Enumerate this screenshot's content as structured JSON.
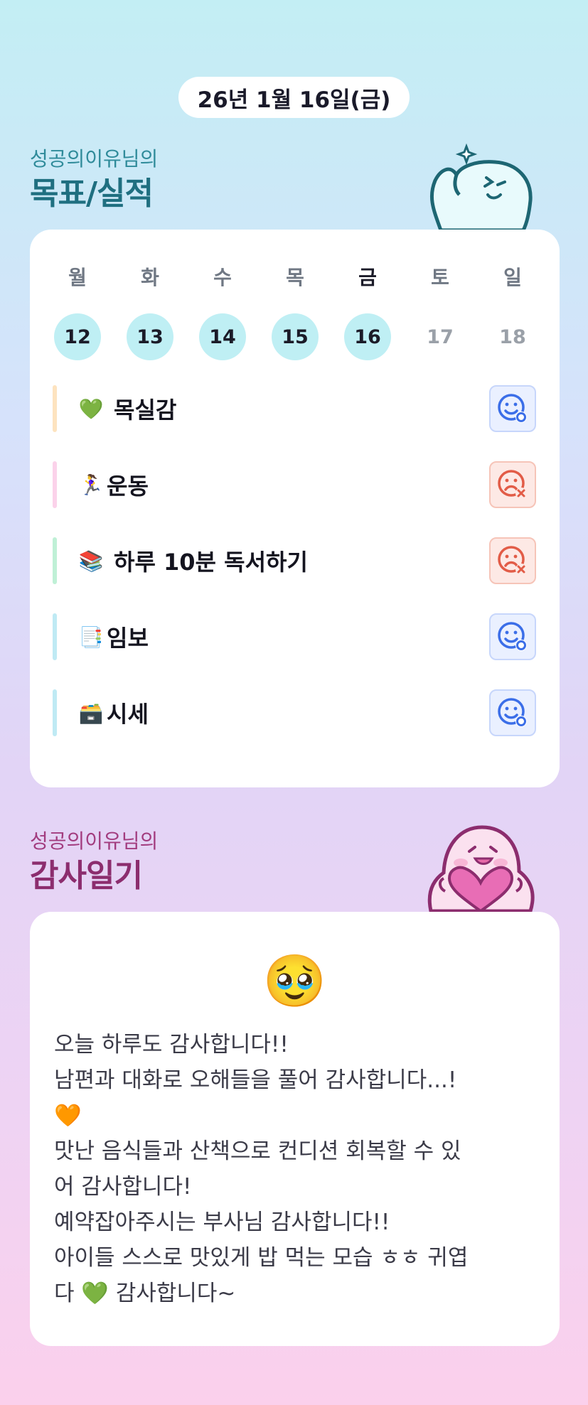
{
  "header": {
    "date": "26년 1월 16일(금)"
  },
  "goals_section": {
    "subtitle": "성공의이유님의",
    "title": "목표/실적",
    "week": [
      {
        "label": "월",
        "date": "12",
        "state": "done"
      },
      {
        "label": "화",
        "date": "13",
        "state": "done"
      },
      {
        "label": "수",
        "date": "14",
        "state": "done"
      },
      {
        "label": "목",
        "date": "15",
        "state": "done"
      },
      {
        "label": "금",
        "date": "16",
        "state": "today"
      },
      {
        "label": "토",
        "date": "17",
        "state": "future"
      },
      {
        "label": "일",
        "date": "18",
        "state": "future"
      }
    ],
    "goals": [
      {
        "icon": "💚",
        "name": "목실감",
        "status": "success",
        "bar_color": "#fde3bf"
      },
      {
        "icon": "🏃‍♀️",
        "name": "운동",
        "status": "fail",
        "bar_color": "#fbd2ea"
      },
      {
        "icon": "📚",
        "name": "하루 10분 독서하기",
        "status": "fail",
        "bar_color": "#bff0d6"
      },
      {
        "icon": "📑",
        "name": "임보",
        "status": "success",
        "bar_color": "#bfeaf4"
      },
      {
        "icon": "🗃️",
        "name": "시세",
        "status": "success",
        "bar_color": "#bfeaf4"
      }
    ]
  },
  "gratitude_section": {
    "subtitle": "성공의이유님의",
    "title": "감사일기",
    "emoji": "🥹",
    "text": "오늘 하루도 감사합니다!!\n남편과 대화로 오해들을 풀어 감사합니다...!\n🧡\n맛난 음식들과 산책으로 컨디션 회복할 수 있\n어 감사합니다!\n예약잡아주시는 부사님 감사합니다!!\n아이들 스스로 맛있게 밥 먹는 모습 ㅎㅎ 귀엽\n다 💚 감사합니다~"
  },
  "colors": {
    "goals_title": "#2a7a8a",
    "gratitude_title": "#8c2d6e",
    "success": "#3b6ee8",
    "fail": "#e25c47"
  }
}
